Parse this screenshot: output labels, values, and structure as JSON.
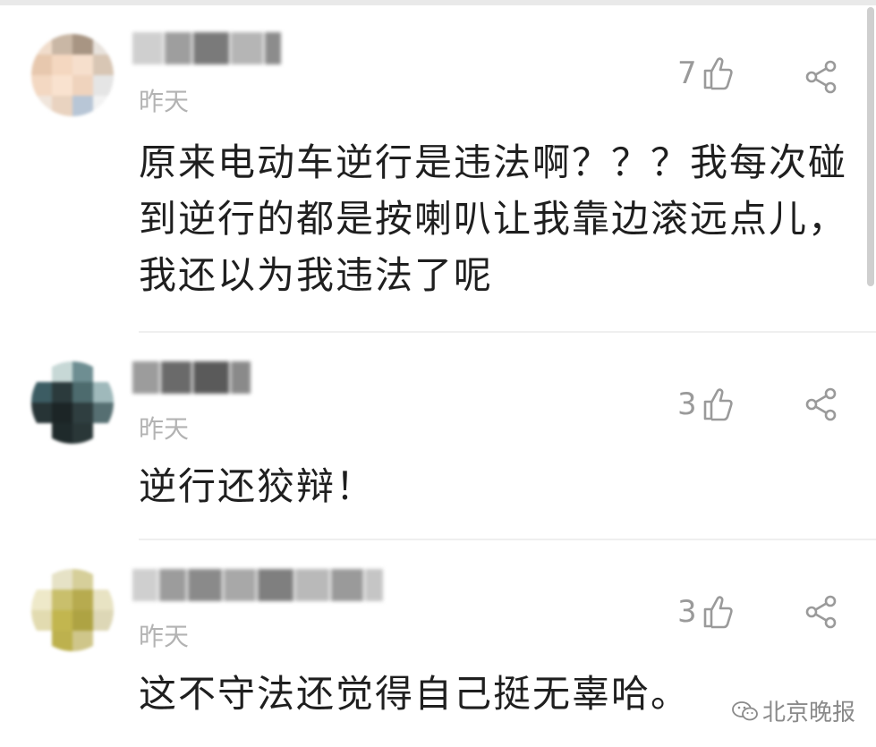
{
  "comments": [
    {
      "time": "昨天",
      "likes": "7",
      "text": "原来电动车逆行是违法啊？？？我每次碰到逆行的都是按喇叭让我靠边滚远点儿，我还以为我违法了呢"
    },
    {
      "time": "昨天",
      "likes": "3",
      "text": "逆行还狡辩！"
    },
    {
      "time": "昨天",
      "likes": "3",
      "text": "这不守法还觉得自己挺无辜哈。"
    }
  ],
  "watermark": {
    "label": "北京晚报",
    "icon": "wechat-icon"
  },
  "icons": {
    "like": "thumbs-up-icon",
    "share": "share-icon"
  }
}
